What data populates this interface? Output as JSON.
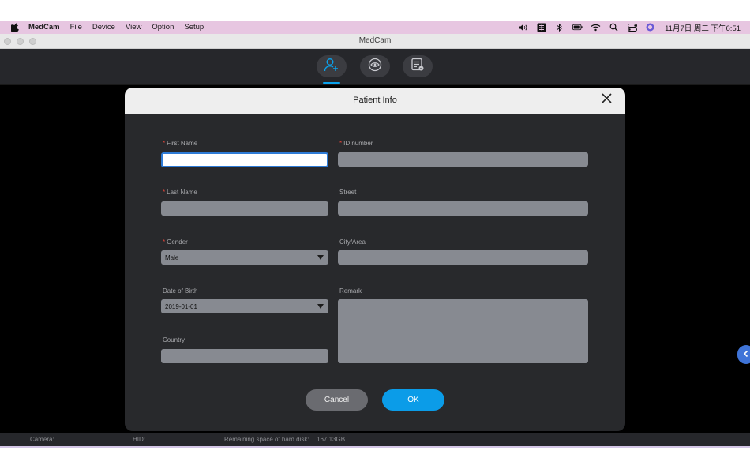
{
  "menubar": {
    "app_name": "MedCam",
    "items": [
      "File",
      "Device",
      "View",
      "Option",
      "Setup"
    ],
    "clock": "11月7日 周二 下午6:51",
    "status_icons": [
      "volume-icon",
      "input-method-icon",
      "bluetooth-icon",
      "battery-icon",
      "wifi-icon",
      "spotlight-search-icon",
      "control-center-icon",
      "siri-icon"
    ]
  },
  "window": {
    "title": "MedCam"
  },
  "toolbar": {
    "buttons": [
      "add-patient-icon",
      "preview-eye-icon",
      "records-icon"
    ],
    "accent_color": "#0aa3ee"
  },
  "dialog": {
    "title": "Patient Info",
    "fields": {
      "first_name": {
        "label": "First Name",
        "value": ""
      },
      "last_name": {
        "label": "Last Name",
        "value": ""
      },
      "gender": {
        "label": "Gender",
        "value": "Male"
      },
      "dob": {
        "label": "Date of Birth",
        "value": "2019-01-01"
      },
      "country": {
        "label": "Country",
        "value": ""
      },
      "id_number": {
        "label": "ID number",
        "value": ""
      },
      "street": {
        "label": "Street",
        "value": ""
      },
      "city": {
        "label": "City/Area",
        "value": ""
      },
      "remark": {
        "label": "Remark",
        "value": ""
      }
    },
    "required_marker": "*",
    "cancel_label": "Cancel",
    "ok_label": "OK",
    "ok_color": "#0b9ce8"
  },
  "statusbar": {
    "camera_label": "Camera:",
    "hid_label": "HID:",
    "disk_label": "Remaining space of hard disk:",
    "disk_value": "167.13GB"
  }
}
